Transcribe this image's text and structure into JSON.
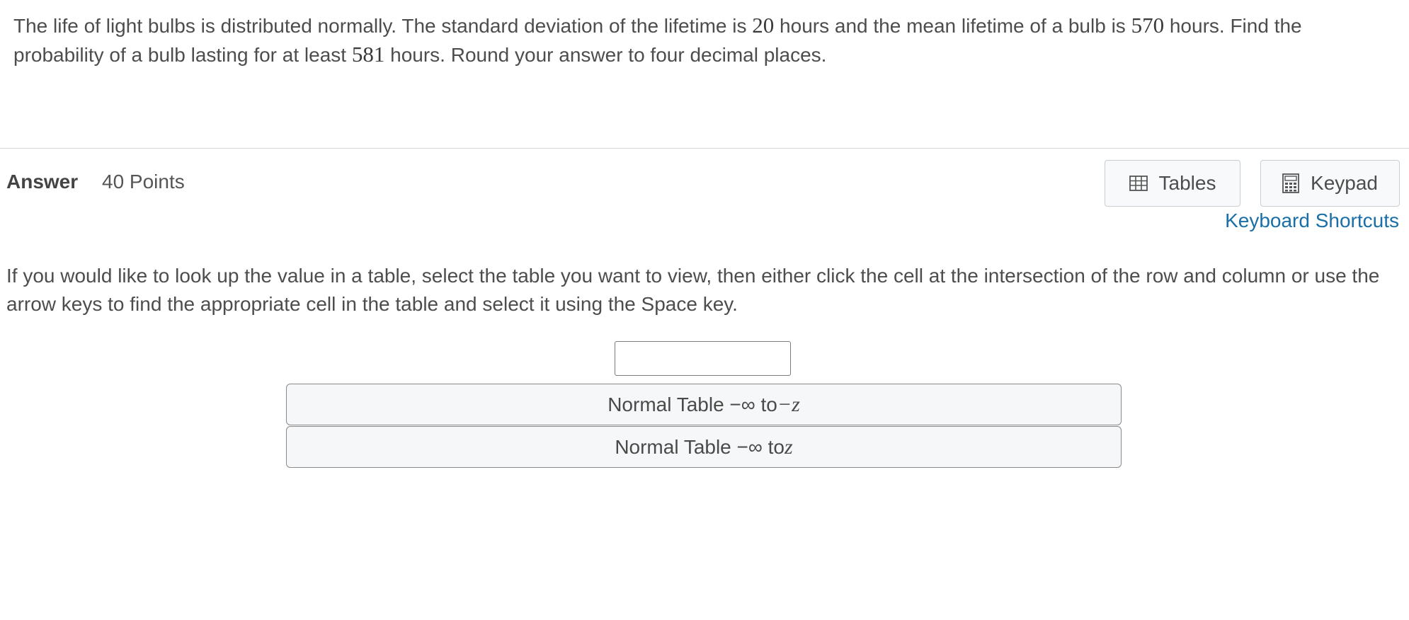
{
  "question": {
    "part1": "The life of light bulbs is distributed normally. The standard deviation of the lifetime is ",
    "sd": "20",
    "part2": " hours and the mean lifetime of a bulb is ",
    "mean": "570",
    "part3": " hours. Find the probability of a bulb lasting for at least ",
    "threshold": "581",
    "part4": " hours. Round your answer to four decimal places."
  },
  "answer": {
    "label": "Answer",
    "points": "40 Points"
  },
  "toolbar": {
    "tables_label": "Tables",
    "keypad_label": "Keypad",
    "tables_icon": "table-grid-icon",
    "keypad_icon": "calculator-icon",
    "shortcuts_label": "Keyboard Shortcuts",
    "link_color": "#1a6fa8"
  },
  "instructions": "If you would like to look up the value in a table, select the table you want to view, then either click the cell at the intersection of the row and column or use the arrow keys to find the appropriate cell in the table and select it using the Space key.",
  "input": {
    "value": "",
    "placeholder": ""
  },
  "tables": [
    {
      "prefix": "Normal Table −∞ to ",
      "var": "−z"
    },
    {
      "prefix": "Normal Table −∞ to ",
      "var": "z"
    }
  ]
}
